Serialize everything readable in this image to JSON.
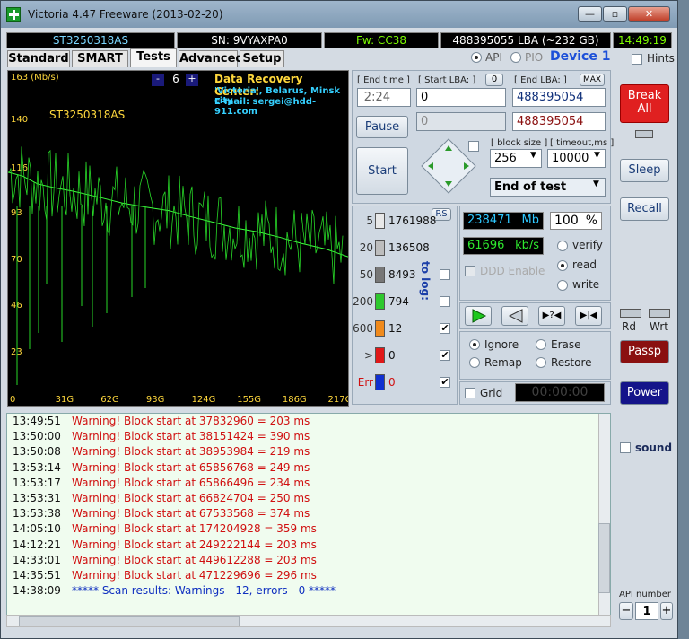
{
  "window": {
    "title": "Victoria 4.47  Freeware (2013-02-20)",
    "controls": [
      "—",
      "▫",
      "✕"
    ]
  },
  "infobar": {
    "model": "ST3250318AS",
    "serial": "SN: 9VYAXPA0",
    "firmware": "Fw: CC38",
    "lba": "488395055 LBA (~232 GB)",
    "clock": "14:49:19"
  },
  "tabs": [
    "Standard",
    "SMART",
    "Tests",
    "Advanced",
    "Setup"
  ],
  "iface": {
    "api": "API",
    "pio": "PIO",
    "device": "Device 1",
    "hints": "Hints"
  },
  "graph": {
    "speed_label": "163 (Mb/s)",
    "drive": "ST3250318AS",
    "zoom_minus": "-",
    "zoom_value": "6",
    "zoom_plus": "+",
    "drc_title": "Data Recovery Center:",
    "drc_line1": "'Victoria', Belarus, Minsk city",
    "drc_line2": "E-mail: sergei@hdd-911.com",
    "y_ticks": [
      "140",
      "116",
      "93",
      "70",
      "46",
      "23"
    ],
    "x_ticks": [
      "0",
      "31G",
      "62G",
      "93G",
      "124G",
      "155G",
      "186G",
      "217G"
    ]
  },
  "chart_data": {
    "type": "line",
    "title": "",
    "xlabel": "",
    "ylabel": "(Mb/s)",
    "ylim": [
      0,
      163
    ],
    "xlim": [
      0,
      232
    ],
    "x": [
      0,
      10,
      20,
      31,
      45,
      62,
      78,
      93,
      110,
      124,
      140,
      155,
      170,
      186,
      200,
      217,
      232
    ],
    "values": [
      114,
      112,
      108,
      106,
      104,
      101,
      98,
      96,
      94,
      91,
      88,
      85,
      83,
      80,
      77,
      74,
      70
    ]
  },
  "controls": {
    "end_time_lbl": "[ End time ]",
    "end_time": "2:24",
    "start_lba_lbl": "[ Start LBA: ]",
    "start_lba_btn": "0",
    "start_lba": "0",
    "end_lba_lbl": "[ End LBA: ]",
    "end_lba_max": "MAX",
    "end_lba": "488395054",
    "cur_lba": "0",
    "cur_end": "488395054",
    "pause": "Pause",
    "start": "Start",
    "block_size_lbl": "[ block size ]",
    "block_size": "256",
    "timeout_lbl": "[ timeout,ms ]",
    "timeout": "10000",
    "mode": "End of test"
  },
  "stats": {
    "rs": "RS",
    "to_log": "to log:",
    "rows": [
      {
        "thr": "5",
        "count": "1761988",
        "color": "#e8e8e8"
      },
      {
        "thr": "20",
        "count": "136508",
        "color": "#bdbdbd"
      },
      {
        "thr": "50",
        "count": "8493",
        "color": "#777777"
      },
      {
        "thr": "200",
        "count": "794",
        "color": "#2ec82e"
      },
      {
        "thr": "600",
        "count": "12",
        "color": "#f08a1c"
      },
      {
        "thr": ">",
        "count": "0",
        "color": "#e01818"
      },
      {
        "thr": "Err",
        "count": "0",
        "color": "#1030d0"
      }
    ]
  },
  "progress": {
    "mb": "238471",
    "mb_unit": "Mb",
    "pct": "100",
    "pct_unit": "%",
    "kbs": "61696",
    "kbs_unit": "kb/s",
    "ddd": "DDD Enable"
  },
  "ops": {
    "verify": "verify",
    "read": "read",
    "write": "write",
    "ignore": "Ignore",
    "erase": "Erase",
    "remap": "Remap",
    "restore": "Restore",
    "grid": "Grid",
    "timer": "00:00:00"
  },
  "side": {
    "break": "Break All",
    "sleep": "Sleep",
    "recall": "Recall",
    "rd": "Rd",
    "wrt": "Wrt",
    "passp": "Passp",
    "power": "Power",
    "sound": "sound",
    "api_number_lbl": "API number",
    "api_minus": "−",
    "api_number": "1",
    "api_plus": "+"
  },
  "log": [
    {
      "time": "13:49:51",
      "msg": "Warning! Block start at 37832960 = 203 ms",
      "color": "#d01010"
    },
    {
      "time": "13:50:00",
      "msg": "Warning! Block start at 38151424 = 390 ms",
      "color": "#d01010"
    },
    {
      "time": "13:50:08",
      "msg": "Warning! Block start at 38953984 = 219 ms",
      "color": "#d01010"
    },
    {
      "time": "13:53:14",
      "msg": "Warning! Block start at 65856768 = 249 ms",
      "color": "#d01010"
    },
    {
      "time": "13:53:17",
      "msg": "Warning! Block start at 65866496 = 234 ms",
      "color": "#d01010"
    },
    {
      "time": "13:53:31",
      "msg": "Warning! Block start at 66824704 = 250 ms",
      "color": "#d01010"
    },
    {
      "time": "13:53:38",
      "msg": "Warning! Block start at 67533568 = 374 ms",
      "color": "#d01010"
    },
    {
      "time": "14:05:10",
      "msg": "Warning! Block start at 174204928 = 359 ms",
      "color": "#d01010"
    },
    {
      "time": "14:12:21",
      "msg": "Warning! Block start at 249222144 = 203 ms",
      "color": "#d01010"
    },
    {
      "time": "14:33:01",
      "msg": "Warning! Block start at 449612288 = 203 ms",
      "color": "#d01010"
    },
    {
      "time": "14:35:51",
      "msg": "Warning! Block start at 471229696 = 296 ms",
      "color": "#d01010"
    },
    {
      "time": "14:38:09",
      "msg": "***** Scan results: Warnings - 12, errors - 0 *****",
      "color": "#1030c0"
    }
  ]
}
